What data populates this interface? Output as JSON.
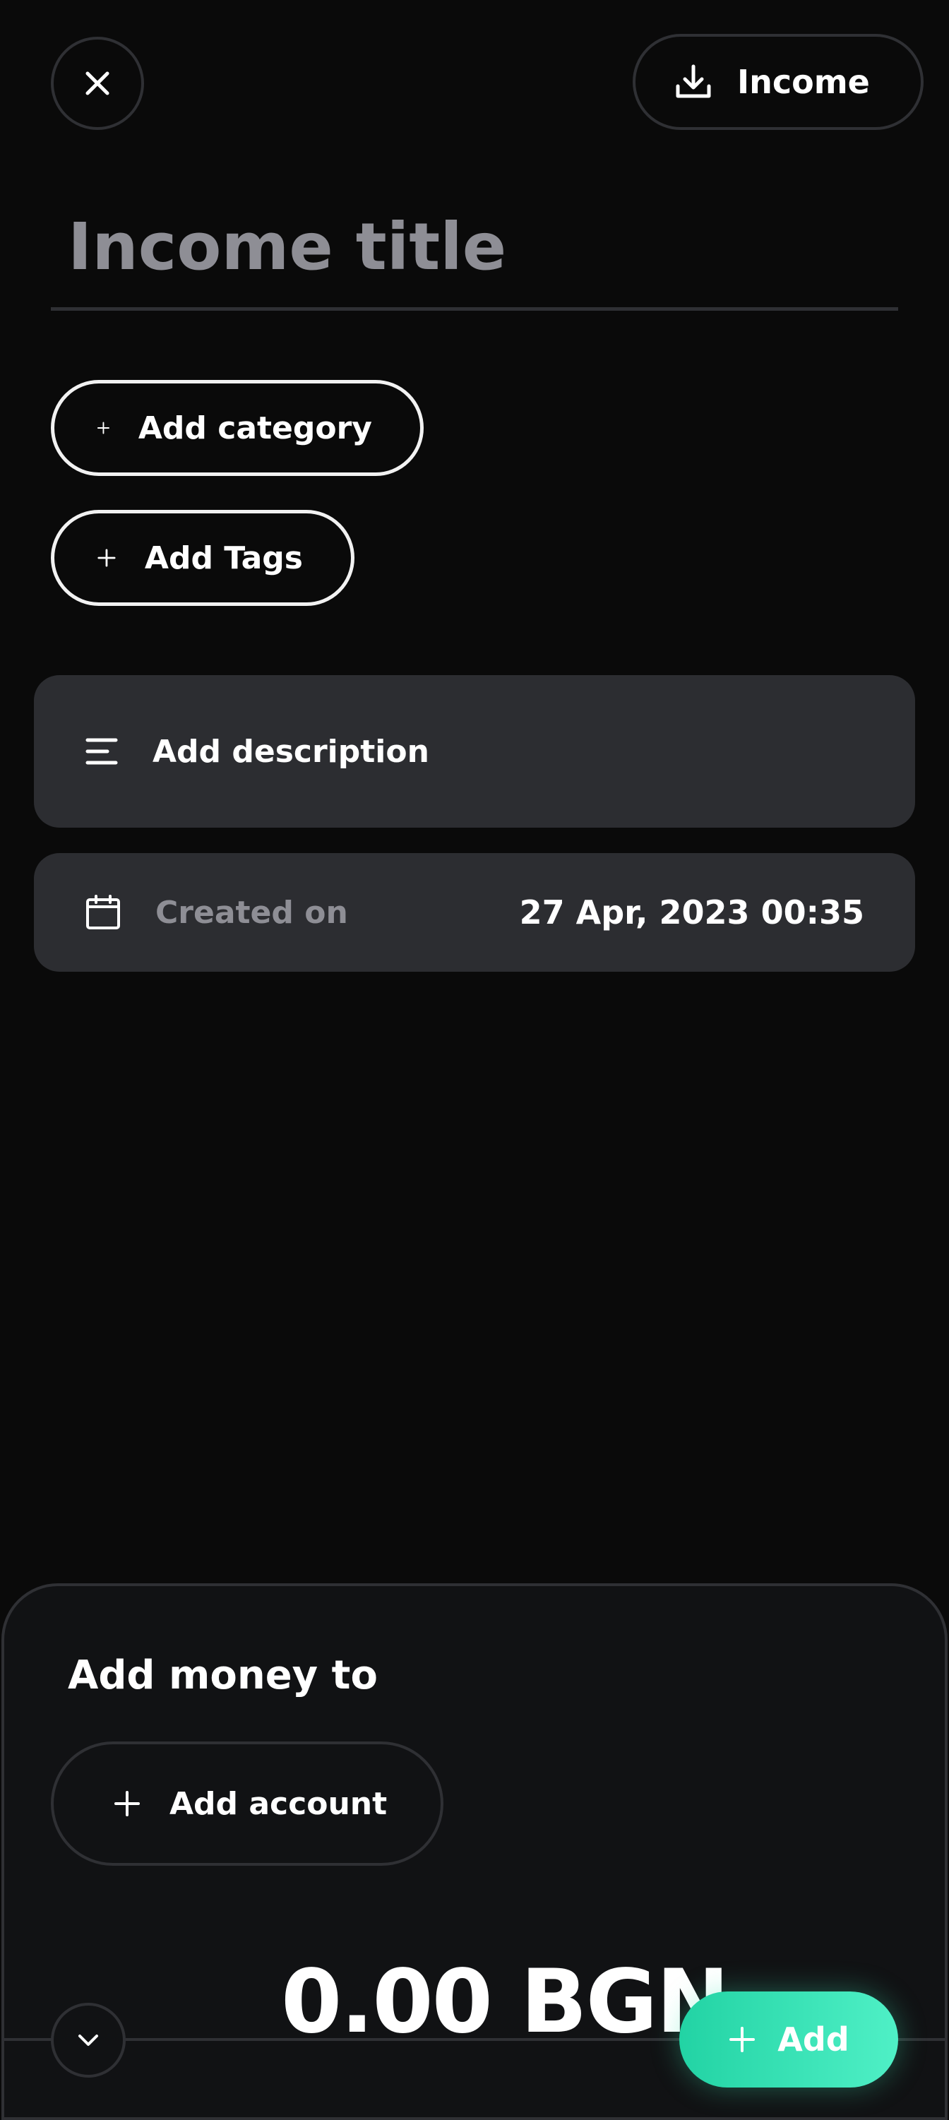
{
  "header": {
    "type_label": "Income"
  },
  "title_field": {
    "placeholder": "Income title",
    "value": ""
  },
  "chips": {
    "category_label": "Add category",
    "tags_label": "Add Tags"
  },
  "description": {
    "label": "Add description"
  },
  "created": {
    "label": "Created on",
    "value": "27 Apr, 2023 00:35"
  },
  "sheet": {
    "title": "Add money to",
    "add_account_label": "Add account",
    "amount": "0.00 BGN",
    "submit_label": "Add"
  },
  "colors": {
    "background": "#0a0a0a",
    "card": "#2c2d31",
    "muted": "#8e8e95",
    "accent_start": "#22d3a4",
    "accent_end": "#4ff0c6"
  },
  "icons": {
    "close": "close-icon",
    "income": "download-icon",
    "plus": "plus-icon",
    "description": "menu-lines-icon",
    "calendar": "calendar-icon",
    "collapse": "chevron-down-icon"
  }
}
